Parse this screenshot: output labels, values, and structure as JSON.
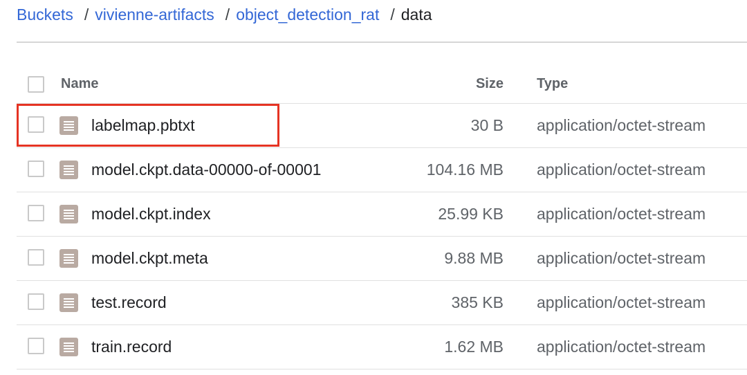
{
  "breadcrumb": {
    "items": [
      {
        "label": "Buckets"
      },
      {
        "label": "vivienne-artifacts"
      },
      {
        "label": "object_detection_rat"
      }
    ],
    "separator": "/",
    "current": "data"
  },
  "table": {
    "columns": {
      "name": "Name",
      "size": "Size",
      "type": "Type"
    },
    "rows": [
      {
        "name": "labelmap.pbtxt",
        "size": "30 B",
        "type": "application/octet-stream",
        "highlighted": true
      },
      {
        "name": "model.ckpt.data-00000-of-00001",
        "size": "104.16 MB",
        "type": "application/octet-stream"
      },
      {
        "name": "model.ckpt.index",
        "size": "25.99 KB",
        "type": "application/octet-stream"
      },
      {
        "name": "model.ckpt.meta",
        "size": "9.88 MB",
        "type": "application/octet-stream"
      },
      {
        "name": "test.record",
        "size": "385 KB",
        "type": "application/octet-stream"
      },
      {
        "name": "train.record",
        "size": "1.62 MB",
        "type": "application/octet-stream"
      }
    ]
  },
  "icons": {
    "file": "file-icon",
    "checkbox": "checkbox"
  },
  "colors": {
    "link": "#3367d6",
    "highlight": "#e53323",
    "file_icon": "#b9aaa2"
  }
}
